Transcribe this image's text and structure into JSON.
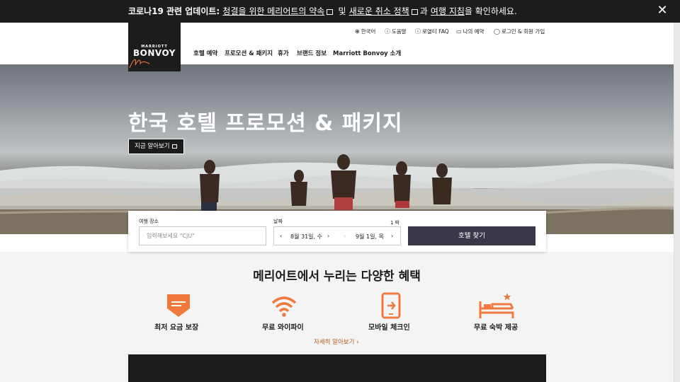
{
  "banner": {
    "prefix": "코로나19 관련 업데이트:",
    "link1": "청결을 위한 메리어트의 약속",
    "and": "및",
    "link2": "새로운 취소 정책",
    "mid": "과",
    "link3": "여행 지침",
    "suffix": "을 확인하세요.",
    "close": "✕"
  },
  "logo": {
    "top": "MARRIOTT",
    "main": "BONVOY"
  },
  "utility": {
    "language": "한국어",
    "help": "도움말",
    "faq": "로열티 FAQ",
    "my_trips": "나의 예약",
    "login": "로그인 & 회원 가입"
  },
  "nav": {
    "hotel_booking": "호텔 예약",
    "promotions": "프로모션 & 패키지",
    "vacation": "휴가",
    "brands": "브랜드 정보",
    "about": "Marriott Bonvoy 소개"
  },
  "hero": {
    "title": "한국 호텔 프로모션 & 패키지",
    "button": "지금 알아보기"
  },
  "search": {
    "destination_label": "여행 장소",
    "destination_placeholder": "입력해보세요 \"CJU\"",
    "dates_label": "날짜",
    "nights": "1 박",
    "checkin": "8월 31일, 수",
    "checkout": "9월 1일, 목",
    "submit": "호텔 찾기"
  },
  "benefits": {
    "title": "메리어트에서 누리는 다양한 혜택",
    "items": [
      {
        "label": "최저 요금 보장",
        "icon": "price-tag-icon"
      },
      {
        "label": "무료 와이파이",
        "icon": "wifi-icon"
      },
      {
        "label": "모바일 체크인",
        "icon": "mobile-checkin-icon"
      },
      {
        "label": "무료 숙박 제공",
        "icon": "bed-icon"
      }
    ],
    "more": "자세히 알아보기"
  },
  "colors": {
    "accent": "#f07a3e",
    "dark": "#1c1c1c",
    "button": "#3a3848",
    "link": "#b35a1b"
  }
}
